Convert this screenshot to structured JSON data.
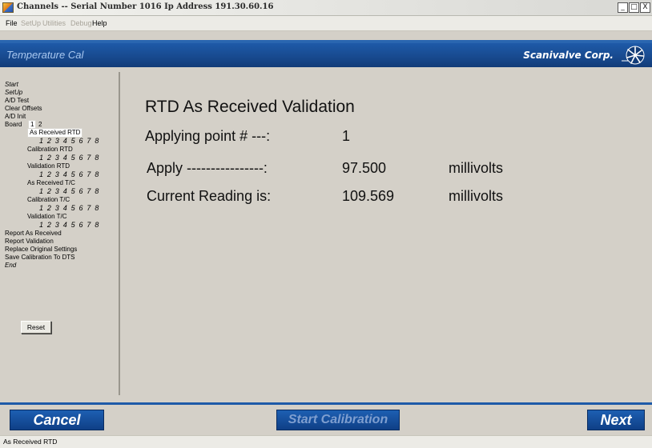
{
  "window": {
    "title": "Channels -- Serial Number 1016 Ip Address 191.30.60.16",
    "controls": [
      "_",
      "□",
      "X"
    ]
  },
  "menu": {
    "items": [
      {
        "label": "File",
        "enabled": true
      },
      {
        "label": "SetUp",
        "enabled": false
      },
      {
        "label": "Utilities",
        "enabled": false
      },
      {
        "label": "Debug",
        "enabled": false
      },
      {
        "label": "Help",
        "enabled": true
      }
    ]
  },
  "banner": {
    "screen_title": "Temperature Cal",
    "logo_text": "Scanivalve Corp.",
    "logo_icon": "scanivalve-logo-icon"
  },
  "sidebar": {
    "start": "Start",
    "setup": "SetUp",
    "ad_test": "A/D Test",
    "clear_offsets": "Clear Offsets",
    "ad_init": "A/D Init",
    "board_label": "Board",
    "board_1": "1",
    "board_2": "2",
    "as_received_rtd": "As Received RTD",
    "calibration_rtd": "Calibration RTD",
    "validation_rtd": "Validation RTD",
    "as_received_tc": "As Received T/C",
    "calibration_tc": "Calibration T/C",
    "validation_tc": "Validation T/C",
    "channels": "1 2 3 4 5 6 7 8",
    "report_as_received": "Report As Received",
    "report_validation": "Report Validation",
    "replace_original": "Replace Original Settings",
    "save_calibration": "Save Calibration To DTS",
    "end": "End",
    "reset": "Reset"
  },
  "main": {
    "heading": "RTD As Received Validation",
    "applying_label": "Applying point # ---:",
    "applying_value": "1",
    "apply_label": "Apply ----------------:",
    "apply_value": "97.500",
    "apply_unit": "millivolts",
    "current_label": "Current Reading is:",
    "current_value": "109.569",
    "current_unit": "millivolts"
  },
  "bottom": {
    "cancel": "Cancel",
    "start_calibration": "Start Calibration",
    "next": "Next"
  },
  "status": {
    "text": "As Received RTD"
  },
  "colors": {
    "banner_blue": "#1e5aa8",
    "button_blue": "#0f3f86",
    "panel_gray": "#d4d0c8"
  }
}
